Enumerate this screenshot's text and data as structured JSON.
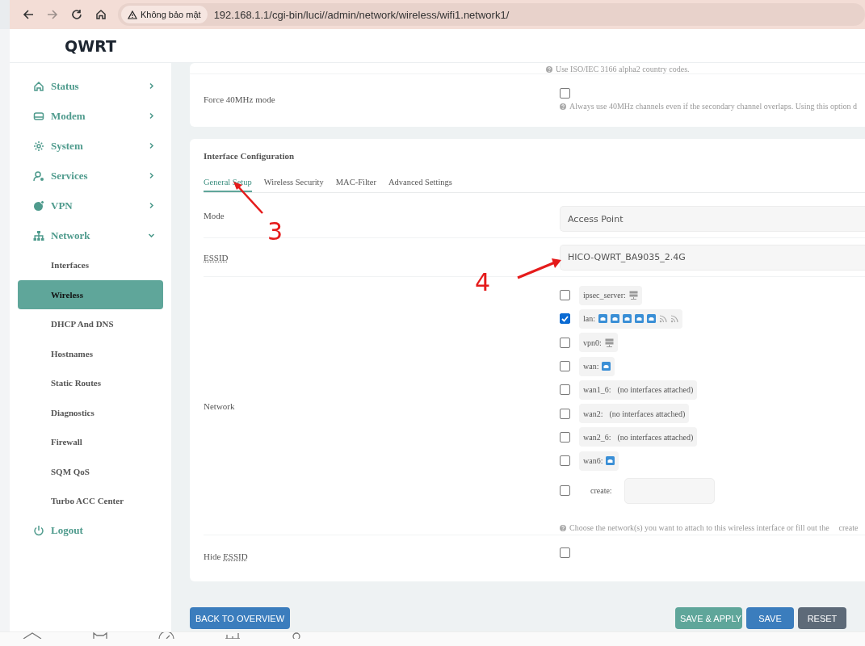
{
  "browser": {
    "security": "Không bảo mật",
    "url": "192.168.1.1/cgi-bin/luci//admin/network/wireless/wifi1.network1/"
  },
  "brand": "QWRT",
  "sidebar": {
    "items": [
      {
        "label": "Status",
        "expanded": false
      },
      {
        "label": "Modem",
        "expanded": false
      },
      {
        "label": "System",
        "expanded": false
      },
      {
        "label": "Services",
        "expanded": false
      },
      {
        "label": "VPN",
        "expanded": false
      },
      {
        "label": "Network",
        "expanded": true,
        "children": [
          {
            "label": "Interfaces",
            "selected": false
          },
          {
            "label": "Wireless",
            "selected": true
          },
          {
            "label": "DHCP And DNS",
            "selected": false
          },
          {
            "label": "Hostnames",
            "selected": false
          },
          {
            "label": "Static Routes",
            "selected": false
          },
          {
            "label": "Diagnostics",
            "selected": false
          },
          {
            "label": "Firewall",
            "selected": false
          },
          {
            "label": "SQM QoS",
            "selected": false
          },
          {
            "label": "Turbo ACC Center",
            "selected": false
          }
        ]
      },
      {
        "label": "Logout"
      }
    ]
  },
  "device_section": {
    "country_hint": "Use ISO/IEC 3166 alpha2 country codes.",
    "force40": {
      "label": "Force 40MHz mode",
      "checked": false,
      "hint": "Always use 40MHz channels even if the secondary channel overlaps. Using this option d"
    }
  },
  "interface_config": {
    "title": "Interface Configuration",
    "tabs": [
      {
        "label": "General Setup",
        "selected": true
      },
      {
        "label": "Wireless Security",
        "selected": false
      },
      {
        "label": "MAC-Filter",
        "selected": false
      },
      {
        "label": "Advanced Settings",
        "selected": false
      }
    ],
    "mode": {
      "label": "Mode",
      "value": "Access Point"
    },
    "essid": {
      "label": "ESSID",
      "value": "HICO-QWRT_BA9035_2.4G"
    },
    "network": {
      "label": "Network",
      "options": [
        {
          "kind": "network",
          "name": "ipsec_server:",
          "checked": false,
          "devices": [
            {
              "kind": "server"
            }
          ]
        },
        {
          "kind": "network",
          "name": "lan:",
          "checked": true,
          "devices": [
            {
              "kind": "ethernet"
            },
            {
              "kind": "ethernet"
            },
            {
              "kind": "ethernet"
            },
            {
              "kind": "ethernet"
            },
            {
              "kind": "ethernet"
            },
            {
              "kind": "wifi"
            },
            {
              "kind": "wifi"
            }
          ]
        },
        {
          "kind": "network",
          "name": "vpn0:",
          "checked": false,
          "devices": [
            {
              "kind": "server"
            }
          ]
        },
        {
          "kind": "network",
          "name": "wan:",
          "checked": false,
          "devices": [
            {
              "kind": "ethernet"
            }
          ]
        },
        {
          "kind": "network",
          "name": "wan1_6:",
          "checked": false,
          "note": "(no interfaces attached)"
        },
        {
          "kind": "network",
          "name": "wan2:",
          "checked": false,
          "note": "(no interfaces attached)"
        },
        {
          "kind": "network",
          "name": "wan2_6:",
          "checked": false,
          "note": "(no interfaces attached)"
        },
        {
          "kind": "network",
          "name": "wan6:",
          "checked": false,
          "devices": [
            {
              "kind": "ethernet"
            }
          ]
        },
        {
          "kind": "create",
          "name": "create:",
          "checked": false
        }
      ],
      "hint": "Choose the network(s) you want to attach to this wireless interface or fill out the",
      "hint_code": "create"
    },
    "hide_essid": {
      "label": "Hide",
      "label_abbr": "ESSID",
      "checked": false
    }
  },
  "annotations": [
    {
      "label": "3"
    },
    {
      "label": "4"
    }
  ],
  "buttons": {
    "back": "BACK TO OVERVIEW",
    "save_apply": "SAVE & APPLY",
    "save": "SAVE",
    "reset": "RESET"
  }
}
